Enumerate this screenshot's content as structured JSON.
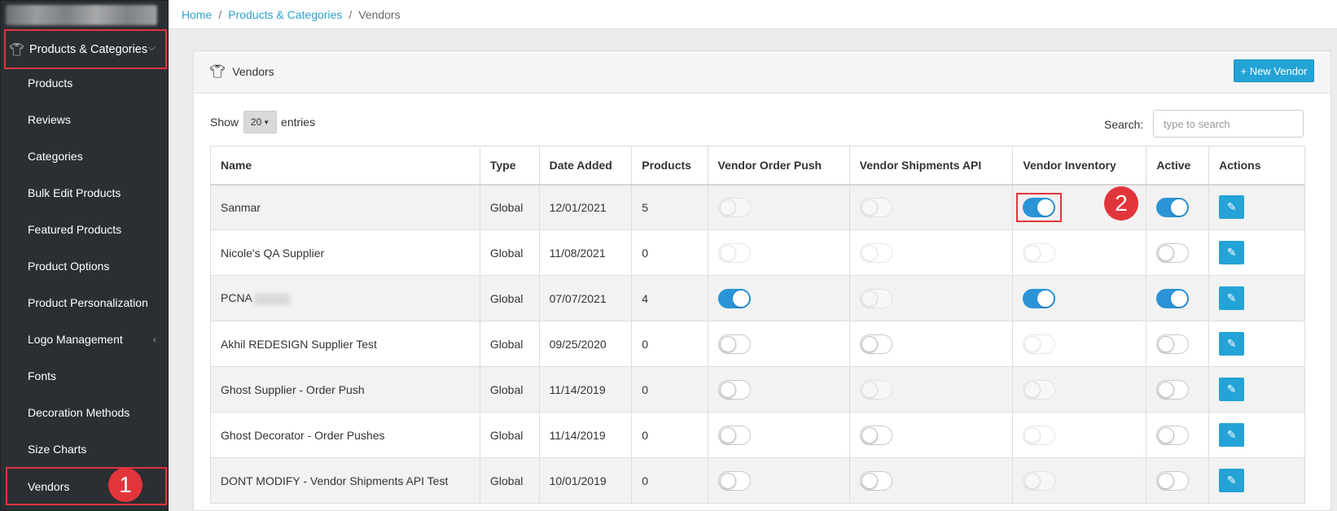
{
  "breadcrumb": {
    "home": "Home",
    "section": "Products & Categories",
    "current": "Vendors"
  },
  "sidebar": {
    "parent": {
      "label": "Products & Categories",
      "icon": "tshirt-icon",
      "caret": "chevron-down-icon"
    },
    "items": [
      {
        "label": "Products"
      },
      {
        "label": "Reviews"
      },
      {
        "label": "Categories"
      },
      {
        "label": "Bulk Edit Products"
      },
      {
        "label": "Featured Products"
      },
      {
        "label": "Product Options"
      },
      {
        "label": "Product Personalization"
      },
      {
        "label": "Logo Management",
        "has_submenu": true
      },
      {
        "label": "Fonts"
      },
      {
        "label": "Decoration Methods"
      },
      {
        "label": "Size Charts"
      },
      {
        "label": "Vendors",
        "active": true
      }
    ]
  },
  "annotations": {
    "step1": "1",
    "step2": "2",
    "highlight_color": "#e2353b"
  },
  "panel": {
    "title": "Vendors",
    "icon": "tshirt-icon",
    "new_button": "+ New Vendor",
    "show_label": "Show",
    "entries_value": "20",
    "entries_label": "entries",
    "search_label": "Search:",
    "search_placeholder": "type to search"
  },
  "table": {
    "headers": [
      "Name",
      "Type",
      "Date Added",
      "Products",
      "Vendor Order Push",
      "Vendor Shipments API",
      "Vendor Inventory",
      "Active",
      "Actions"
    ],
    "rows": [
      {
        "name": "Sanmar",
        "type": "Global",
        "date": "12/01/2021",
        "products": "5",
        "order_push": "disabled",
        "shipments": "disabled",
        "inventory": "on",
        "active": "on"
      },
      {
        "name": "Nicole's QA Supplier",
        "type": "Global",
        "date": "11/08/2021",
        "products": "0",
        "order_push": "disabled",
        "shipments": "disabled",
        "inventory": "disabled",
        "active": "off"
      },
      {
        "name": "PCNA",
        "type": "Global",
        "date": "07/07/2021",
        "products": "4",
        "order_push": "on",
        "shipments": "disabled",
        "inventory": "on",
        "active": "on"
      },
      {
        "name": "Akhil REDESIGN Supplier Test",
        "type": "Global",
        "date": "09/25/2020",
        "products": "0",
        "order_push": "off",
        "shipments": "off",
        "inventory": "disabled",
        "active": "off"
      },
      {
        "name": "Ghost Supplier - Order Push",
        "type": "Global",
        "date": "11/14/2019",
        "products": "0",
        "order_push": "off",
        "shipments": "disabled",
        "inventory": "disabled",
        "active": "off"
      },
      {
        "name": "Ghost Decorator - Order Pushes",
        "type": "Global",
        "date": "11/14/2019",
        "products": "0",
        "order_push": "off",
        "shipments": "off",
        "inventory": "disabled",
        "active": "off"
      },
      {
        "name": "DONT MODIFY - Vendor Shipments API Test",
        "type": "Global",
        "date": "10/01/2019",
        "products": "0",
        "order_push": "off",
        "shipments": "off",
        "inventory": "disabled",
        "active": "off"
      }
    ]
  },
  "colors": {
    "accent": "#23a3d6",
    "toggle_on": "#2a94d6",
    "sidebar_bg": "#2a2f33",
    "link": "#2ea2cc"
  }
}
